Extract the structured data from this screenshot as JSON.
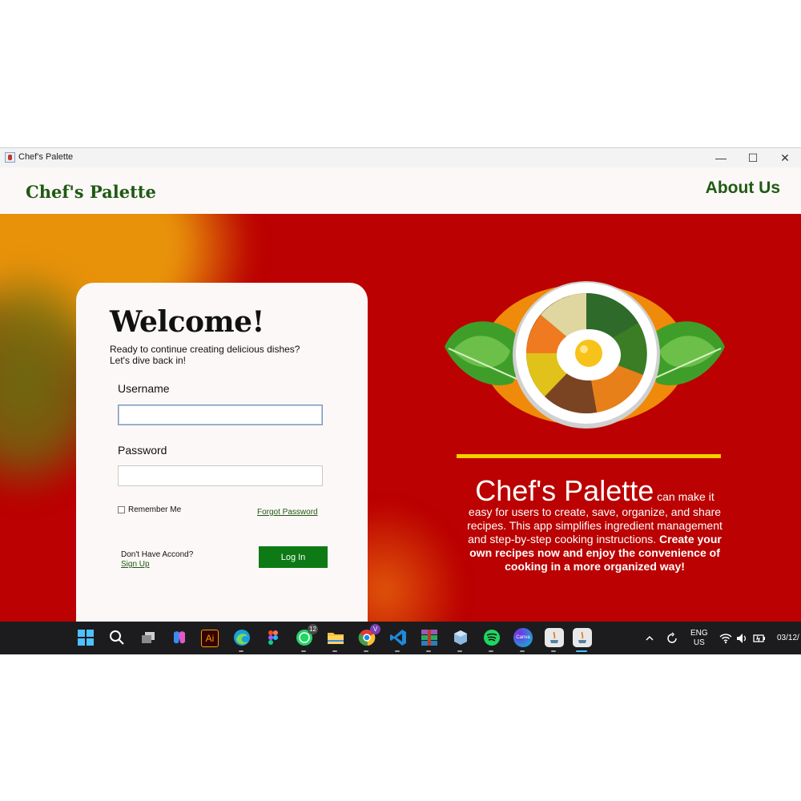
{
  "window": {
    "title": "Chef's Palette",
    "controls": [
      "—",
      "☐",
      "✕"
    ]
  },
  "header": {
    "brand": "Chef's Palette",
    "about_link": "About Us"
  },
  "login": {
    "heading": "Welcome!",
    "subtitle": "Ready to continue creating delicious dishes?\nLet's dive back in!",
    "username_label": "Username",
    "username_value": "",
    "password_label": "Password",
    "password_value": "",
    "remember_label": "Remember Me",
    "forgot_label": "Forgot Password",
    "no_account_text": "Don't Have Accond?",
    "signup_label": "Sign Up",
    "login_button": "Log In"
  },
  "hero": {
    "brand": "Chef's Palette",
    "text_regular": " can make it easy for users to create, save, organize, and share recipes. This app simplifies ingredient management and step-by-step cooking instructions. ",
    "text_bold": "Create your own recipes now and enjoy the convenience of cooking in a more organized way!"
  },
  "taskbar": {
    "icons": [
      "windows-start-icon",
      "search-icon",
      "task-view-icon",
      "copilot-icon",
      "illustrator-icon",
      "edge-icon",
      "figma-icon",
      "whatsapp-icon",
      "file-explorer-icon",
      "chrome-icon",
      "vscode-icon",
      "winrar-icon",
      "virtualbox-icon",
      "spotify-icon",
      "canva-icon",
      "java-icon",
      "java-icon-active"
    ],
    "illustrator_label": "Ai",
    "canva_label": "Canva",
    "whatsapp_badge": "12",
    "chrome_badge": "V",
    "language_line1": "ENG",
    "language_line2": "US",
    "date_partial": "03/12/"
  },
  "colors": {
    "brand_green": "#1f5a12",
    "background_red": "#bb0101",
    "button_green": "#0e7a16",
    "accent_yellow": "#f5d000",
    "card_background": "#fcf8f7"
  }
}
